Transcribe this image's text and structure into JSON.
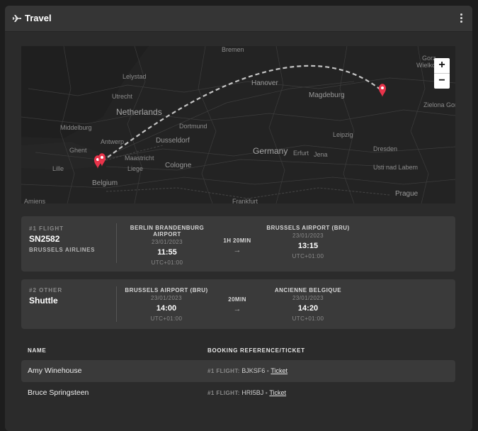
{
  "panel": {
    "title": "Travel",
    "icon": "plane-icon",
    "menu_icon": "more-vertical-icon"
  },
  "map": {
    "zoom_in": "+",
    "zoom_out": "−",
    "route_color": "#bdbdbd",
    "marker_color": "#e8334a",
    "labels": {
      "bremen": "Bremen",
      "lelystad": "Lelystad",
      "utrecht": "Utrecht",
      "netherlands": "Netherlands",
      "hanover": "Hanover",
      "magdeburg": "Magdeburg",
      "middelburg": "Middelburg",
      "antwerp": "Antwerp",
      "dortmund": "Dortmund",
      "dusseldorf": "Dusseldorf",
      "ghent": "Ghent",
      "maastricht": "Maastricht",
      "leipzig": "Leipzig",
      "germany": "Germany",
      "erfurt": "Erfurt",
      "jena": "Jena",
      "dresden": "Dresden",
      "lille": "Lille",
      "liege": "Liege",
      "cologne": "Cologne",
      "belgium": "Belgium",
      "usti": "Usti nad Labem",
      "prague": "Prague",
      "frankfurt": "Frankfurt",
      "amiens": "Amiens",
      "gorzow": "Gorz",
      "wielkopolski": "Wielkop",
      "zielona": "Zielona Gor"
    }
  },
  "legs": [
    {
      "kind": "#1 FLIGHT",
      "code": "SN2582",
      "carrier": "BRUSSELS AIRLINES",
      "from": {
        "name": "BERLIN BRANDENBURG AIRPORT",
        "date": "23/01/2023",
        "time": "11:55",
        "tz": "UTC+01:00"
      },
      "duration": "1H 20MIN",
      "arrow": "→",
      "to": {
        "name": "BRUSSELS AIRPORT (BRU)",
        "date": "23/01/2023",
        "time": "13:15",
        "tz": "UTC+01:00"
      }
    },
    {
      "kind": "#2 OTHER",
      "code": "Shuttle",
      "carrier": "",
      "from": {
        "name": "BRUSSELS AIRPORT (BRU)",
        "date": "23/01/2023",
        "time": "14:00",
        "tz": "UTC+01:00"
      },
      "duration": "20MIN",
      "arrow": "→",
      "to": {
        "name": "ANCIENNE BELGIQUE",
        "date": "23/01/2023",
        "time": "14:20",
        "tz": "UTC+01:00"
      }
    }
  ],
  "table": {
    "headers": {
      "name": "NAME",
      "booking": "BOOKING REFERENCE/TICKET"
    },
    "rows": [
      {
        "name": "Amy Winehouse",
        "leg": "#1 FLIGHT:",
        "ref": "BJKSF6",
        "sep": "•",
        "ticket": "Ticket"
      },
      {
        "name": "Bruce Springsteen",
        "leg": "#1 FLIGHT:",
        "ref": "HRI5BJ",
        "sep": "•",
        "ticket": "Ticket"
      }
    ]
  }
}
